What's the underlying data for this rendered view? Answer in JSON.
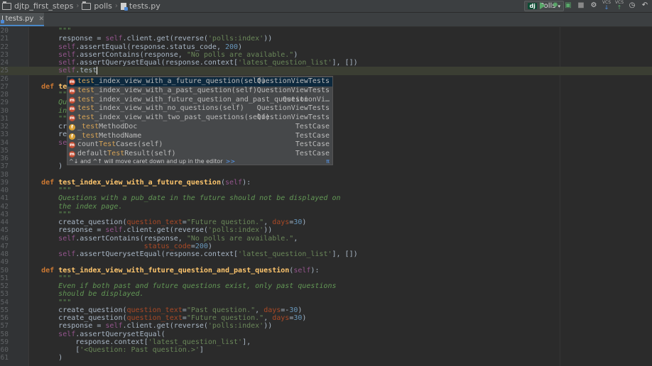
{
  "breadcrumb": {
    "project": "djtp_first_steps",
    "folder": "polls",
    "file": "tests.py"
  },
  "run_config": {
    "label": "Polls"
  },
  "toolbar": {
    "vcs_label_1": "VCS",
    "vcs_label_2": "VCS"
  },
  "tabs": [
    {
      "label": "tests.py"
    }
  ],
  "colors": {
    "keyword": "#cc7832",
    "function": "#ffc66d",
    "self": "#94558d",
    "string": "#6a8759",
    "number": "#6897bb",
    "docstring": "#629755",
    "selection": "#0d293e"
  },
  "editor": {
    "lines": [
      {
        "n": "20",
        "parts": [
          {
            "t": "        \"\"\"",
            "c": "doc"
          }
        ]
      },
      {
        "n": "21",
        "parts": [
          {
            "t": "        response = "
          },
          {
            "t": "self",
            "c": "slf"
          },
          {
            "t": ".client.get(reverse("
          },
          {
            "t": "'polls:index'",
            "c": "str"
          },
          {
            "t": "))"
          }
        ]
      },
      {
        "n": "22",
        "parts": [
          {
            "t": "        "
          },
          {
            "t": "self",
            "c": "slf"
          },
          {
            "t": ".assertEqual(response.status_code, "
          },
          {
            "t": "200",
            "c": "num"
          },
          {
            "t": ")"
          }
        ]
      },
      {
        "n": "23",
        "parts": [
          {
            "t": "        "
          },
          {
            "t": "self",
            "c": "slf"
          },
          {
            "t": ".assertContains(response, "
          },
          {
            "t": "\"No polls are available.\"",
            "c": "str"
          },
          {
            "t": ")"
          }
        ]
      },
      {
        "n": "24",
        "parts": [
          {
            "t": "        "
          },
          {
            "t": "self",
            "c": "slf"
          },
          {
            "t": ".assertQuerysetEqual(response.context["
          },
          {
            "t": "'latest_question_list'",
            "c": "str"
          },
          {
            "t": "], [])"
          }
        ]
      },
      {
        "n": "25",
        "hl": true,
        "parts": [
          {
            "t": "        "
          },
          {
            "t": "self",
            "c": "slf"
          },
          {
            "t": ".test",
            "c": "cur"
          }
        ]
      },
      {
        "n": "26",
        "parts": []
      },
      {
        "n": "27",
        "parts": [
          {
            "t": "    "
          },
          {
            "t": "def ",
            "c": "kw"
          },
          {
            "t": "te",
            "c": "fn"
          }
        ]
      },
      {
        "n": "28",
        "parts": [
          {
            "t": "        \"\"\"",
            "c": "doc"
          }
        ]
      },
      {
        "n": "29",
        "parts": [
          {
            "t": "        Qu",
            "c": "doc"
          }
        ]
      },
      {
        "n": "30",
        "parts": [
          {
            "t": "        in",
            "c": "doc"
          }
        ]
      },
      {
        "n": "31",
        "parts": [
          {
            "t": "        \"\"\"",
            "c": "doc"
          }
        ]
      },
      {
        "n": "32",
        "parts": [
          {
            "t": "        cre"
          }
        ]
      },
      {
        "n": "33",
        "parts": [
          {
            "t": "        re"
          }
        ]
      },
      {
        "n": "34",
        "parts": [
          {
            "t": "        "
          },
          {
            "t": "se",
            "c": "slf"
          }
        ]
      },
      {
        "n": "35",
        "parts": []
      },
      {
        "n": "36",
        "parts": []
      },
      {
        "n": "37",
        "parts": [
          {
            "t": "        )"
          }
        ]
      },
      {
        "n": "38",
        "parts": []
      },
      {
        "n": "39",
        "parts": [
          {
            "t": "    "
          },
          {
            "t": "def ",
            "c": "kw"
          },
          {
            "t": "test_index_view_with_a_future_question",
            "c": "fn"
          },
          {
            "t": "("
          },
          {
            "t": "self",
            "c": "slf"
          },
          {
            "t": "):"
          }
        ]
      },
      {
        "n": "40",
        "parts": [
          {
            "t": "        \"\"\"",
            "c": "doc"
          }
        ]
      },
      {
        "n": "41",
        "parts": [
          {
            "t": "        Questions with a pub_date in the future should not be displayed on",
            "c": "doc"
          }
        ]
      },
      {
        "n": "42",
        "parts": [
          {
            "t": "        the index page.",
            "c": "doc"
          }
        ]
      },
      {
        "n": "43",
        "parts": [
          {
            "t": "        \"\"\"",
            "c": "doc"
          }
        ]
      },
      {
        "n": "44",
        "parts": [
          {
            "t": "        create_question("
          },
          {
            "t": "question_text",
            "c": "kwa"
          },
          {
            "t": "="
          },
          {
            "t": "\"Future question.\"",
            "c": "str"
          },
          {
            "t": ", "
          },
          {
            "t": "days",
            "c": "kwa"
          },
          {
            "t": "="
          },
          {
            "t": "30",
            "c": "num"
          },
          {
            "t": ")"
          }
        ]
      },
      {
        "n": "45",
        "parts": [
          {
            "t": "        response = "
          },
          {
            "t": "self",
            "c": "slf"
          },
          {
            "t": ".client.get(reverse("
          },
          {
            "t": "'polls:index'",
            "c": "str"
          },
          {
            "t": "))"
          }
        ]
      },
      {
        "n": "46",
        "parts": [
          {
            "t": "        "
          },
          {
            "t": "self",
            "c": "slf"
          },
          {
            "t": ".assertContains(response, "
          },
          {
            "t": "\"No polls are available.\"",
            "c": "str"
          },
          {
            "t": ","
          }
        ]
      },
      {
        "n": "47",
        "parts": [
          {
            "t": "                            "
          },
          {
            "t": "status_code",
            "c": "kwa"
          },
          {
            "t": "="
          },
          {
            "t": "200",
            "c": "num"
          },
          {
            "t": ")"
          }
        ]
      },
      {
        "n": "48",
        "parts": [
          {
            "t": "        "
          },
          {
            "t": "self",
            "c": "slf"
          },
          {
            "t": ".assertQuerysetEqual(response.context["
          },
          {
            "t": "'latest_question_list'",
            "c": "str"
          },
          {
            "t": "], [])"
          }
        ]
      },
      {
        "n": "49",
        "parts": []
      },
      {
        "n": "50",
        "parts": [
          {
            "t": "    "
          },
          {
            "t": "def ",
            "c": "kw"
          },
          {
            "t": "test_index_view_with_future_question_and_past_question",
            "c": "fn"
          },
          {
            "t": "("
          },
          {
            "t": "self",
            "c": "slf"
          },
          {
            "t": "):"
          }
        ]
      },
      {
        "n": "51",
        "parts": [
          {
            "t": "        \"\"\"",
            "c": "doc"
          }
        ]
      },
      {
        "n": "52",
        "parts": [
          {
            "t": "        Even if both past and future questions exist, only past questions",
            "c": "doc"
          }
        ]
      },
      {
        "n": "53",
        "parts": [
          {
            "t": "        should be displayed.",
            "c": "doc"
          }
        ]
      },
      {
        "n": "54",
        "parts": [
          {
            "t": "        \"\"\"",
            "c": "doc"
          }
        ]
      },
      {
        "n": "55",
        "parts": [
          {
            "t": "        create_question("
          },
          {
            "t": "question_text",
            "c": "kwa"
          },
          {
            "t": "="
          },
          {
            "t": "\"Past question.\"",
            "c": "str"
          },
          {
            "t": ", "
          },
          {
            "t": "days",
            "c": "kwa"
          },
          {
            "t": "=-"
          },
          {
            "t": "30",
            "c": "num"
          },
          {
            "t": ")"
          }
        ]
      },
      {
        "n": "56",
        "parts": [
          {
            "t": "        create_question("
          },
          {
            "t": "question_text",
            "c": "kwa"
          },
          {
            "t": "="
          },
          {
            "t": "\"Future question.\"",
            "c": "str"
          },
          {
            "t": ", "
          },
          {
            "t": "days",
            "c": "kwa"
          },
          {
            "t": "="
          },
          {
            "t": "30",
            "c": "num"
          },
          {
            "t": ")"
          }
        ]
      },
      {
        "n": "57",
        "parts": [
          {
            "t": "        response = "
          },
          {
            "t": "self",
            "c": "slf"
          },
          {
            "t": ".client.get(reverse("
          },
          {
            "t": "'polls:index'",
            "c": "str"
          },
          {
            "t": "))"
          }
        ]
      },
      {
        "n": "58",
        "parts": [
          {
            "t": "        "
          },
          {
            "t": "self",
            "c": "slf"
          },
          {
            "t": ".assertQuerysetEqual("
          }
        ]
      },
      {
        "n": "59",
        "parts": [
          {
            "t": "            response.context["
          },
          {
            "t": "'latest_question_list'",
            "c": "str"
          },
          {
            "t": "],"
          }
        ]
      },
      {
        "n": "60",
        "parts": [
          {
            "t": "            ["
          },
          {
            "t": "'<Question: Past question.>'",
            "c": "str"
          },
          {
            "t": "]"
          }
        ]
      },
      {
        "n": "61",
        "parts": [
          {
            "t": "        )"
          }
        ]
      }
    ]
  },
  "completion": {
    "items": [
      {
        "icon": "m",
        "pre": "",
        "match": "test",
        "rest": "_index_view_with_a_future_question(self)",
        "type": "QuestionViewTests",
        "selected": true
      },
      {
        "icon": "m",
        "pre": "",
        "match": "test",
        "rest": "_index_view_with_a_past_question(self)",
        "type": "QuestionViewTests"
      },
      {
        "icon": "m",
        "pre": "",
        "match": "test",
        "rest": "_index_view_with_future_question_and_past_question",
        "type": "QuestionVi…"
      },
      {
        "icon": "m",
        "pre": "",
        "match": "test",
        "rest": "_index_view_with_no_questions(self)",
        "type": "QuestionViewTests"
      },
      {
        "icon": "m",
        "pre": "",
        "match": "test",
        "rest": "_index_view_with_two_past_questions(self)",
        "type": "QuestionViewTests"
      },
      {
        "icon": "f",
        "pre": "_",
        "match": "test",
        "rest": "MethodDoc",
        "type": "TestCase"
      },
      {
        "icon": "f",
        "pre": "_",
        "match": "test",
        "rest": "MethodName",
        "type": "TestCase"
      },
      {
        "icon": "m",
        "pre": "count",
        "match": "Test",
        "rest": "Cases(self)",
        "type": "TestCase"
      },
      {
        "icon": "m",
        "pre": "default",
        "match": "Test",
        "rest": "Result(self)",
        "type": "TestCase"
      }
    ],
    "hint": "^↓ and ^↑ will move caret down and up in the editor",
    "more": ">>",
    "pi": "π"
  }
}
